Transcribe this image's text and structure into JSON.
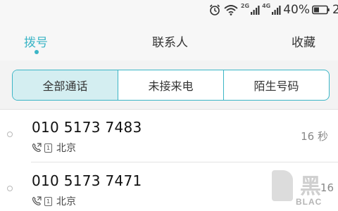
{
  "status_bar": {
    "icons": [
      "alarm-icon",
      "wifi-icon",
      "signal-2g-icon",
      "signal-4g-icon",
      "battery-icon"
    ],
    "net_2g": "2G",
    "net_4g": "4G",
    "battery_percent": "40%",
    "clock_partial": "2"
  },
  "tabs": [
    {
      "label": "拨号",
      "active": true
    },
    {
      "label": "联系人",
      "active": false
    },
    {
      "label": "收藏",
      "active": false
    }
  ],
  "filter": [
    {
      "label": "全部通话",
      "active": true
    },
    {
      "label": "未接来电",
      "active": false
    },
    {
      "label": "陌生号码",
      "active": false
    }
  ],
  "calls": [
    {
      "number": "010 5173 7483",
      "sim": "1",
      "location": "北京",
      "duration": "16 秒",
      "call_icon": "outgoing-call-icon"
    },
    {
      "number": "010 5173 7471",
      "sim": "1",
      "location": "北京",
      "duration": "16",
      "call_icon": "outgoing-call-icon"
    }
  ],
  "watermark": {
    "char": "黑",
    "text": "BLAC"
  },
  "colors": {
    "accent": "#3bb5c6",
    "active_segment_bg": "#d4eef1",
    "header_bg": "#f7f7f7"
  }
}
